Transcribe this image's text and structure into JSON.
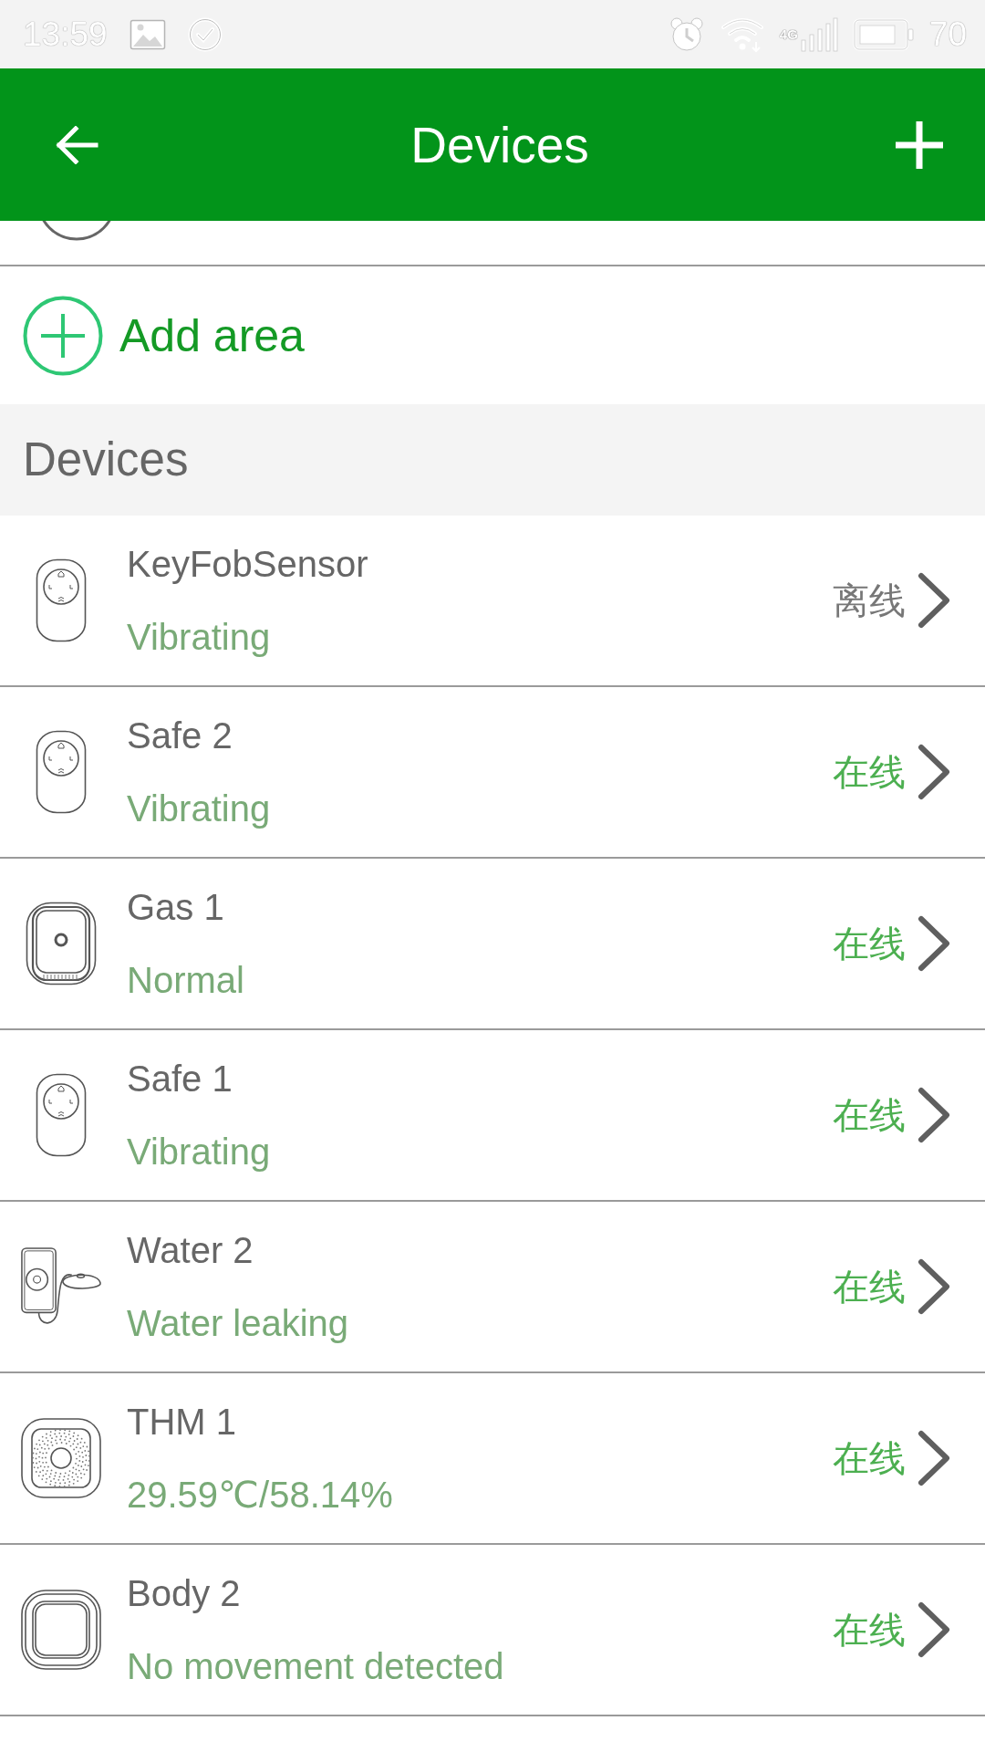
{
  "status_bar": {
    "time": "13:59",
    "network": "4G",
    "battery": "70"
  },
  "header": {
    "title": "Devices"
  },
  "add_area": {
    "label": "Add area"
  },
  "section": {
    "title": "Devices"
  },
  "devices": [
    {
      "kind": "keyfob",
      "name": "KeyFobSensor",
      "status": "Vibrating",
      "connection": "离线",
      "online": false
    },
    {
      "kind": "keyfob",
      "name": "Safe 2",
      "status": "Vibrating",
      "connection": "在线",
      "online": true
    },
    {
      "kind": "gas",
      "name": "Gas 1",
      "status": "Normal",
      "connection": "在线",
      "online": true
    },
    {
      "kind": "keyfob",
      "name": "Safe 1",
      "status": "Vibrating",
      "connection": "在线",
      "online": true
    },
    {
      "kind": "water",
      "name": "Water 2",
      "status": "Water leaking",
      "connection": "在线",
      "online": true
    },
    {
      "kind": "thm",
      "name": "THM 1",
      "status": "29.59℃/58.14%",
      "connection": "在线",
      "online": true
    },
    {
      "kind": "body",
      "name": "Body 2",
      "status": "No movement detected",
      "connection": "在线",
      "online": true
    }
  ]
}
